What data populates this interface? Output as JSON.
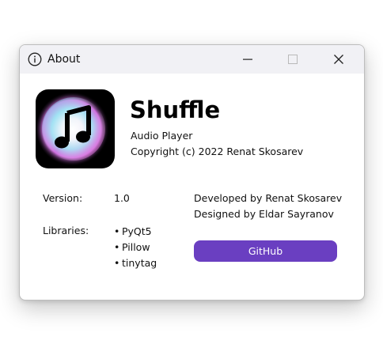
{
  "window": {
    "title": "About",
    "controls": {
      "minimize": "minimize-icon",
      "maximize": "maximize-icon",
      "close": "close-icon"
    }
  },
  "app": {
    "name": "Shuffle",
    "subtitle": "Audio Player",
    "copyright": "Copyright (c) 2022 Renat Skosarev",
    "icon": "music-note-icon"
  },
  "details": {
    "version_label": "Version:",
    "version_value": "1.0",
    "libraries_label": "Libraries:",
    "libraries": [
      "PyQt5",
      "Pillow",
      "tinytag"
    ],
    "developed_by": "Developed by Renat Skosarev",
    "designed_by": "Designed by Eldar Sayranov"
  },
  "github_button": {
    "label": "GitHub"
  },
  "colors": {
    "accent": "#6a3fc1",
    "titlebar": "#f1f1f5"
  }
}
